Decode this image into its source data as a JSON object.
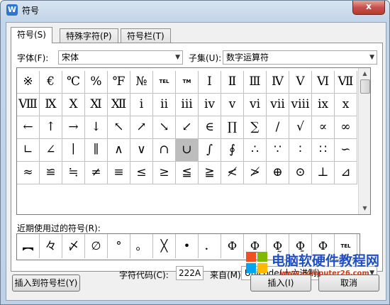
{
  "window": {
    "title": "符号",
    "close_label": "x",
    "app_icon": "W"
  },
  "tabs": [
    {
      "label": "符号(S)"
    },
    {
      "label": "特殊字符(P)"
    },
    {
      "label": "符号栏(T)"
    }
  ],
  "font": {
    "label": "字体(F):",
    "value": "宋体"
  },
  "subset": {
    "label": "子集(U):",
    "value": "数字运算符"
  },
  "grid": {
    "rows": [
      [
        "※",
        "€",
        "℃",
        "%",
        "℉",
        "№",
        "TEL",
        "TM",
        "Ⅰ",
        "Ⅱ",
        "Ⅲ",
        "Ⅳ",
        "Ⅴ",
        "Ⅵ",
        "Ⅶ"
      ],
      [
        "Ⅷ",
        "Ⅸ",
        "Ⅹ",
        "Ⅺ",
        "Ⅻ",
        "ⅰ",
        "ⅱ",
        "ⅲ",
        "ⅳ",
        "ⅴ",
        "ⅵ",
        "ⅶ",
        "ⅷ",
        "ⅸ",
        "ⅹ"
      ],
      [
        "←",
        "↑",
        "→",
        "↓",
        "↖",
        "↗",
        "↘",
        "↙",
        "∈",
        "∏",
        "∑",
        "∕",
        "√",
        "∝",
        "∞"
      ],
      [
        "∟",
        "∠",
        "∣",
        "∥",
        "∧",
        "∨",
        "∩",
        "∪",
        "∫",
        "∮",
        "∴",
        "∵",
        "∶",
        "∷",
        "∽"
      ],
      [
        "≈",
        "≌",
        "≒",
        "≠",
        "≡",
        "≤",
        "≥",
        "≦",
        "≧",
        "≮",
        "≯",
        "⊕",
        "⊙",
        "⊥",
        "⊿"
      ]
    ],
    "selected": {
      "row": 3,
      "col": 7
    }
  },
  "recent": {
    "label": "近期使用过的符号(R):",
    "symbols": [
      "︻",
      "々",
      "〆",
      "∅",
      "°",
      "。",
      "╳",
      "•",
      "．",
      "Ф",
      "Ф̲",
      "Ф̰",
      "Ф̱",
      "Ф",
      "TEL"
    ]
  },
  "char_code": {
    "label": "字符代码(C):",
    "value": "222A"
  },
  "from": {
    "label": "来自(M)",
    "value": "Unicode(十六进制)"
  },
  "buttons": {
    "insert_toolbar": "插入到符号栏(Y)",
    "insert": "插入(I)",
    "cancel": "取消"
  },
  "watermark": {
    "text": "电脑软硬件教程网",
    "url": "www.computer26.com"
  }
}
